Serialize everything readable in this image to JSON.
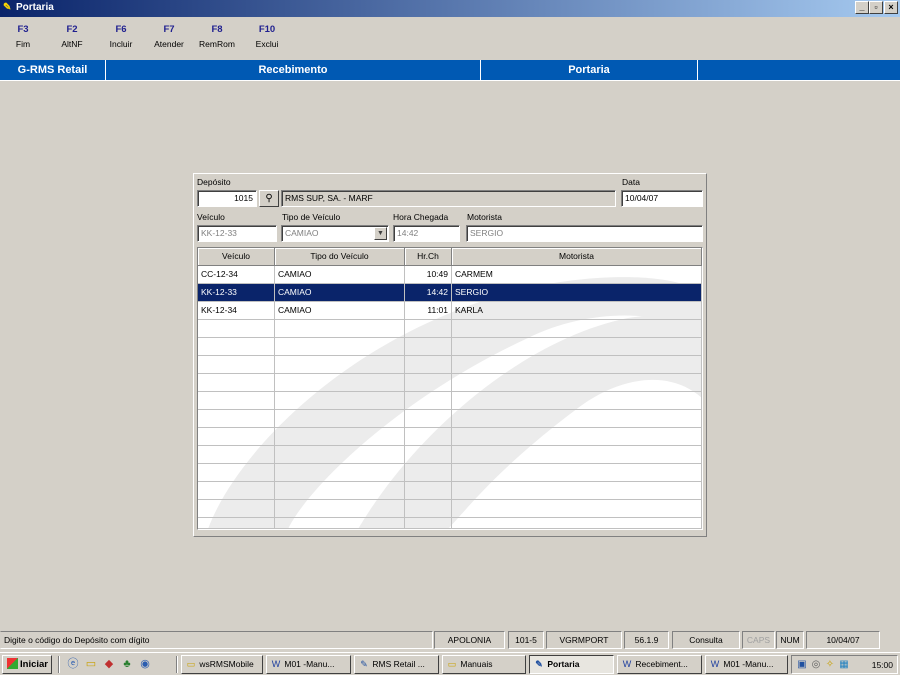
{
  "window": {
    "title": "Portaria",
    "controls": {
      "minimize": "_",
      "maximize": "▫",
      "close": "×"
    }
  },
  "function_keys": [
    {
      "key": "F3",
      "label": "Fim"
    },
    {
      "key": "F2",
      "label": "AltNF"
    },
    {
      "key": "F6",
      "label": "Incluir"
    },
    {
      "key": "F7",
      "label": "Atender"
    },
    {
      "key": "F8",
      "label": "RemRom"
    },
    {
      "key": "F10",
      "label": "Exclui"
    }
  ],
  "header": {
    "app": "G-RMS Retail",
    "module": "Recebimento",
    "screen": "Portaria"
  },
  "form": {
    "deposito_label": "Depósito",
    "deposito_code": "1015",
    "deposito_name": "RMS SUP, SA. - MARF",
    "data_label": "Data",
    "data_value": "10/04/07",
    "veiculo_label": "Veículo",
    "veiculo_value": "KK-12-33",
    "tipo_label": "Tipo de Veículo",
    "tipo_value": "CAMIAO",
    "hora_label": "Hora Chegada",
    "hora_value": "14:42",
    "motorista_label": "Motorista",
    "motorista_value": "SERGIO"
  },
  "grid": {
    "columns": [
      "Veículo",
      "Tipo do Veículo",
      "Hr.Ch",
      "Motorista"
    ],
    "rows": [
      {
        "veiculo": "CC-12-34",
        "tipo": "CAMIAO",
        "hora": "10:49",
        "motorista": "CARMEM"
      },
      {
        "veiculo": "KK-12-33",
        "tipo": "CAMIAO",
        "hora": "14:42",
        "motorista": "SERGIO"
      },
      {
        "veiculo": "KK-12-34",
        "tipo": "CAMIAO",
        "hora": "11:01",
        "motorista": "KARLA"
      }
    ],
    "selected_row": 1
  },
  "statusbar": {
    "message": "Digite o código do Depósito com dígito",
    "server": "APOLONIA",
    "code": "101-5",
    "program": "VGRMPORT",
    "version": "56.1.9",
    "mode": "Consulta",
    "caps": "CAPS",
    "num": "NUM",
    "date": "10/04/07"
  },
  "taskbar": {
    "start": "Iniciar",
    "buttons": [
      {
        "label": "wsRMSMobile",
        "icon": "folder-icon"
      },
      {
        "label": "M01 -Manu...",
        "icon": "word-doc-icon"
      },
      {
        "label": "RMS Retail ...",
        "icon": "app-icon"
      },
      {
        "label": "Manuais",
        "icon": "folder-icon"
      },
      {
        "label": "Portaria",
        "icon": "app-icon"
      },
      {
        "label": "Recebiment...",
        "icon": "word-doc-icon"
      },
      {
        "label": "M01 -Manu...",
        "icon": "word-doc-icon"
      }
    ],
    "active_button": 4,
    "clock": "15:00"
  },
  "colors": {
    "header_blue": "#0059b3",
    "selection": "#0a246a",
    "function_key": "#1f1f8f"
  }
}
